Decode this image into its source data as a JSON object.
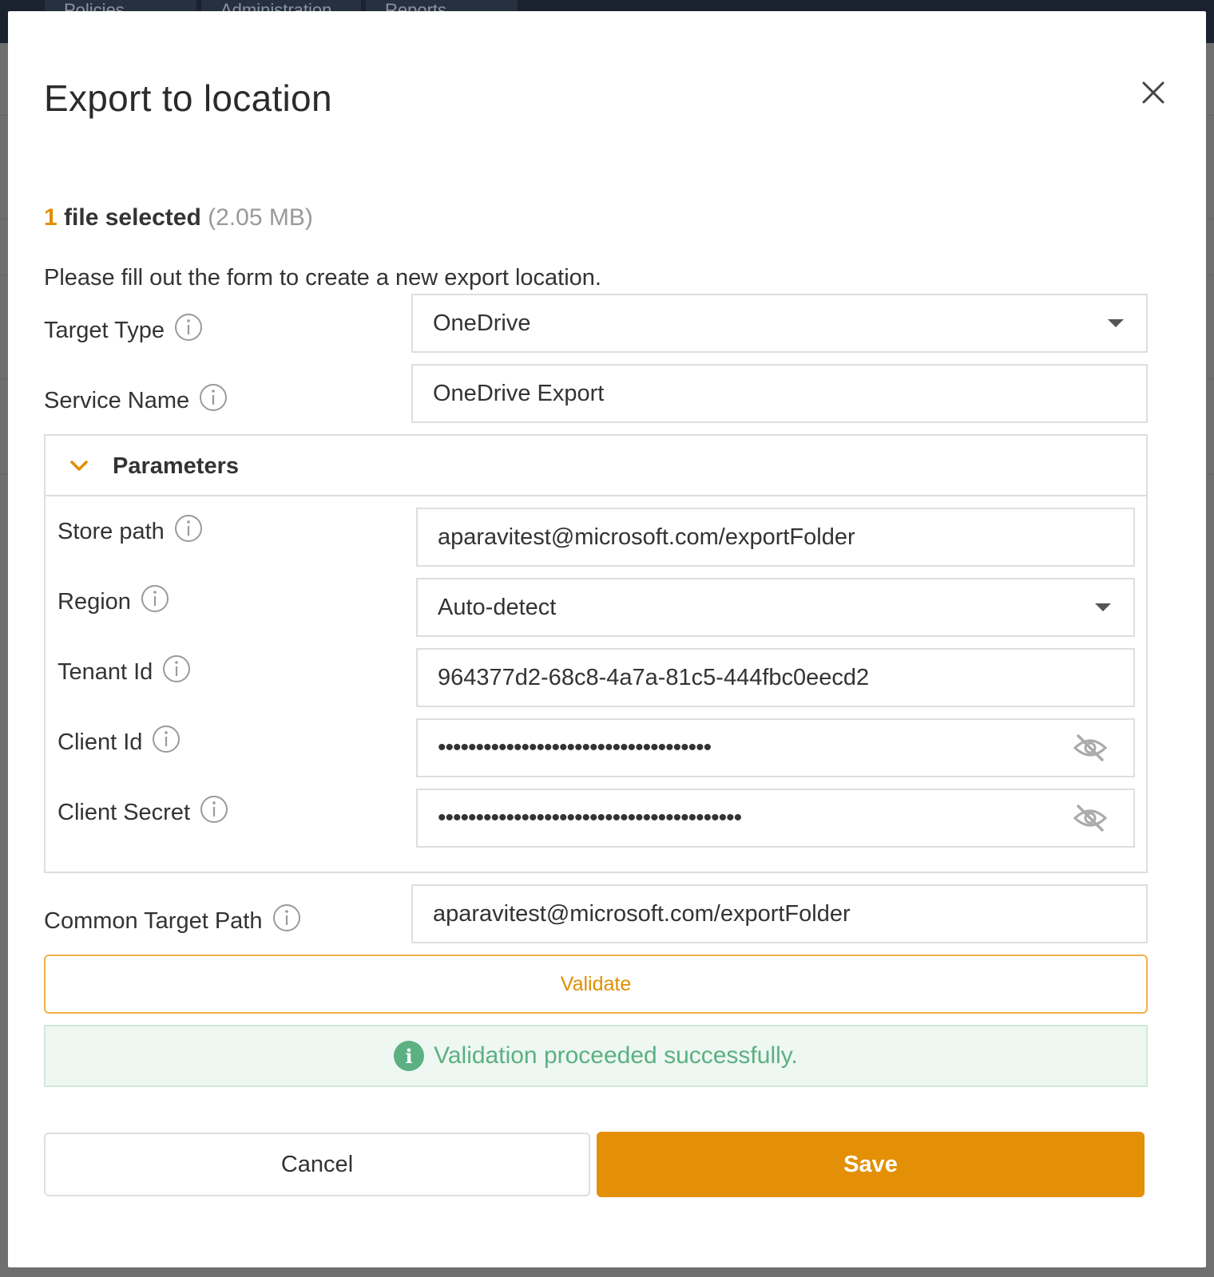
{
  "background": {
    "tabs": [
      "Policies",
      "Administration",
      "Reports"
    ]
  },
  "modal": {
    "title": "Export to location",
    "file_summary": {
      "count": "1",
      "label": "file selected",
      "size": "(2.05 MB)"
    },
    "instruction": "Please fill out the form to create a new export location.",
    "target_type": {
      "label": "Target Type",
      "value": "OneDrive"
    },
    "service_name": {
      "label": "Service Name",
      "value": "OneDrive Export"
    },
    "parameters": {
      "title": "Parameters",
      "store_path": {
        "label": "Store path",
        "value": "aparavitest@microsoft.com/exportFolder"
      },
      "region": {
        "label": "Region",
        "value": "Auto-detect"
      },
      "tenant_id": {
        "label": "Tenant Id",
        "value": "964377d2-68c8-4a7a-81c5-444fbc0eecd2"
      },
      "client_id": {
        "label": "Client Id",
        "value": "••••••••••••••••••••••••••••••••••••"
      },
      "client_secret": {
        "label": "Client Secret",
        "value": "••••••••••••••••••••••••••••••••••••••••"
      }
    },
    "common_target_path": {
      "label": "Common Target Path",
      "value": "aparavitest@microsoft.com/exportFolder"
    },
    "validate_label": "Validate",
    "validation_message": "Validation proceeded successfully.",
    "cancel_label": "Cancel",
    "save_label": "Save"
  },
  "colors": {
    "accent": "#e39007",
    "success": "#5cb082",
    "border": "#dedede"
  }
}
